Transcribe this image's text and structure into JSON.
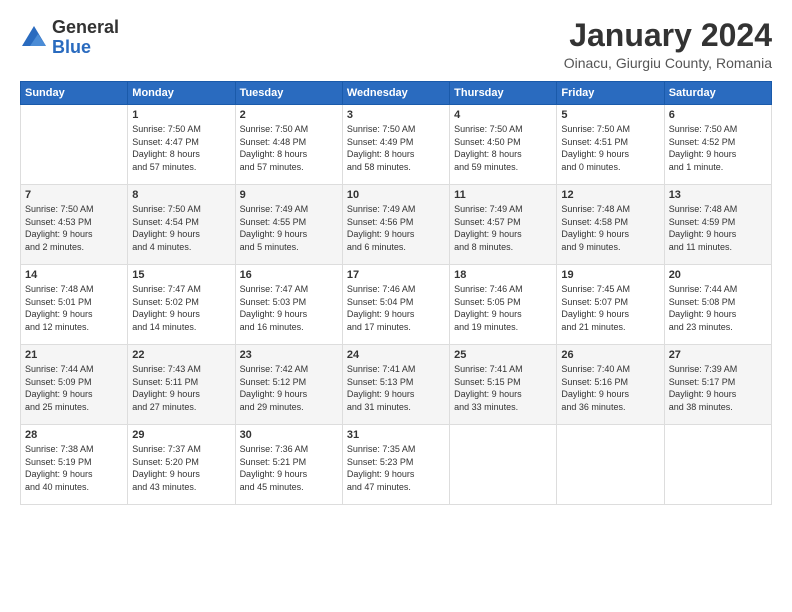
{
  "header": {
    "logo_general": "General",
    "logo_blue": "Blue",
    "month_title": "January 2024",
    "location": "Oinacu, Giurgiu County, Romania"
  },
  "calendar": {
    "days_of_week": [
      "Sunday",
      "Monday",
      "Tuesday",
      "Wednesday",
      "Thursday",
      "Friday",
      "Saturday"
    ],
    "weeks": [
      [
        {
          "day": "",
          "info": ""
        },
        {
          "day": "1",
          "info": "Sunrise: 7:50 AM\nSunset: 4:47 PM\nDaylight: 8 hours\nand 57 minutes."
        },
        {
          "day": "2",
          "info": "Sunrise: 7:50 AM\nSunset: 4:48 PM\nDaylight: 8 hours\nand 57 minutes."
        },
        {
          "day": "3",
          "info": "Sunrise: 7:50 AM\nSunset: 4:49 PM\nDaylight: 8 hours\nand 58 minutes."
        },
        {
          "day": "4",
          "info": "Sunrise: 7:50 AM\nSunset: 4:50 PM\nDaylight: 8 hours\nand 59 minutes."
        },
        {
          "day": "5",
          "info": "Sunrise: 7:50 AM\nSunset: 4:51 PM\nDaylight: 9 hours\nand 0 minutes."
        },
        {
          "day": "6",
          "info": "Sunrise: 7:50 AM\nSunset: 4:52 PM\nDaylight: 9 hours\nand 1 minute."
        }
      ],
      [
        {
          "day": "7",
          "info": "Sunrise: 7:50 AM\nSunset: 4:53 PM\nDaylight: 9 hours\nand 2 minutes."
        },
        {
          "day": "8",
          "info": "Sunrise: 7:50 AM\nSunset: 4:54 PM\nDaylight: 9 hours\nand 4 minutes."
        },
        {
          "day": "9",
          "info": "Sunrise: 7:49 AM\nSunset: 4:55 PM\nDaylight: 9 hours\nand 5 minutes."
        },
        {
          "day": "10",
          "info": "Sunrise: 7:49 AM\nSunset: 4:56 PM\nDaylight: 9 hours\nand 6 minutes."
        },
        {
          "day": "11",
          "info": "Sunrise: 7:49 AM\nSunset: 4:57 PM\nDaylight: 9 hours\nand 8 minutes."
        },
        {
          "day": "12",
          "info": "Sunrise: 7:48 AM\nSunset: 4:58 PM\nDaylight: 9 hours\nand 9 minutes."
        },
        {
          "day": "13",
          "info": "Sunrise: 7:48 AM\nSunset: 4:59 PM\nDaylight: 9 hours\nand 11 minutes."
        }
      ],
      [
        {
          "day": "14",
          "info": "Sunrise: 7:48 AM\nSunset: 5:01 PM\nDaylight: 9 hours\nand 12 minutes."
        },
        {
          "day": "15",
          "info": "Sunrise: 7:47 AM\nSunset: 5:02 PM\nDaylight: 9 hours\nand 14 minutes."
        },
        {
          "day": "16",
          "info": "Sunrise: 7:47 AM\nSunset: 5:03 PM\nDaylight: 9 hours\nand 16 minutes."
        },
        {
          "day": "17",
          "info": "Sunrise: 7:46 AM\nSunset: 5:04 PM\nDaylight: 9 hours\nand 17 minutes."
        },
        {
          "day": "18",
          "info": "Sunrise: 7:46 AM\nSunset: 5:05 PM\nDaylight: 9 hours\nand 19 minutes."
        },
        {
          "day": "19",
          "info": "Sunrise: 7:45 AM\nSunset: 5:07 PM\nDaylight: 9 hours\nand 21 minutes."
        },
        {
          "day": "20",
          "info": "Sunrise: 7:44 AM\nSunset: 5:08 PM\nDaylight: 9 hours\nand 23 minutes."
        }
      ],
      [
        {
          "day": "21",
          "info": "Sunrise: 7:44 AM\nSunset: 5:09 PM\nDaylight: 9 hours\nand 25 minutes."
        },
        {
          "day": "22",
          "info": "Sunrise: 7:43 AM\nSunset: 5:11 PM\nDaylight: 9 hours\nand 27 minutes."
        },
        {
          "day": "23",
          "info": "Sunrise: 7:42 AM\nSunset: 5:12 PM\nDaylight: 9 hours\nand 29 minutes."
        },
        {
          "day": "24",
          "info": "Sunrise: 7:41 AM\nSunset: 5:13 PM\nDaylight: 9 hours\nand 31 minutes."
        },
        {
          "day": "25",
          "info": "Sunrise: 7:41 AM\nSunset: 5:15 PM\nDaylight: 9 hours\nand 33 minutes."
        },
        {
          "day": "26",
          "info": "Sunrise: 7:40 AM\nSunset: 5:16 PM\nDaylight: 9 hours\nand 36 minutes."
        },
        {
          "day": "27",
          "info": "Sunrise: 7:39 AM\nSunset: 5:17 PM\nDaylight: 9 hours\nand 38 minutes."
        }
      ],
      [
        {
          "day": "28",
          "info": "Sunrise: 7:38 AM\nSunset: 5:19 PM\nDaylight: 9 hours\nand 40 minutes."
        },
        {
          "day": "29",
          "info": "Sunrise: 7:37 AM\nSunset: 5:20 PM\nDaylight: 9 hours\nand 43 minutes."
        },
        {
          "day": "30",
          "info": "Sunrise: 7:36 AM\nSunset: 5:21 PM\nDaylight: 9 hours\nand 45 minutes."
        },
        {
          "day": "31",
          "info": "Sunrise: 7:35 AM\nSunset: 5:23 PM\nDaylight: 9 hours\nand 47 minutes."
        },
        {
          "day": "",
          "info": ""
        },
        {
          "day": "",
          "info": ""
        },
        {
          "day": "",
          "info": ""
        }
      ]
    ]
  }
}
